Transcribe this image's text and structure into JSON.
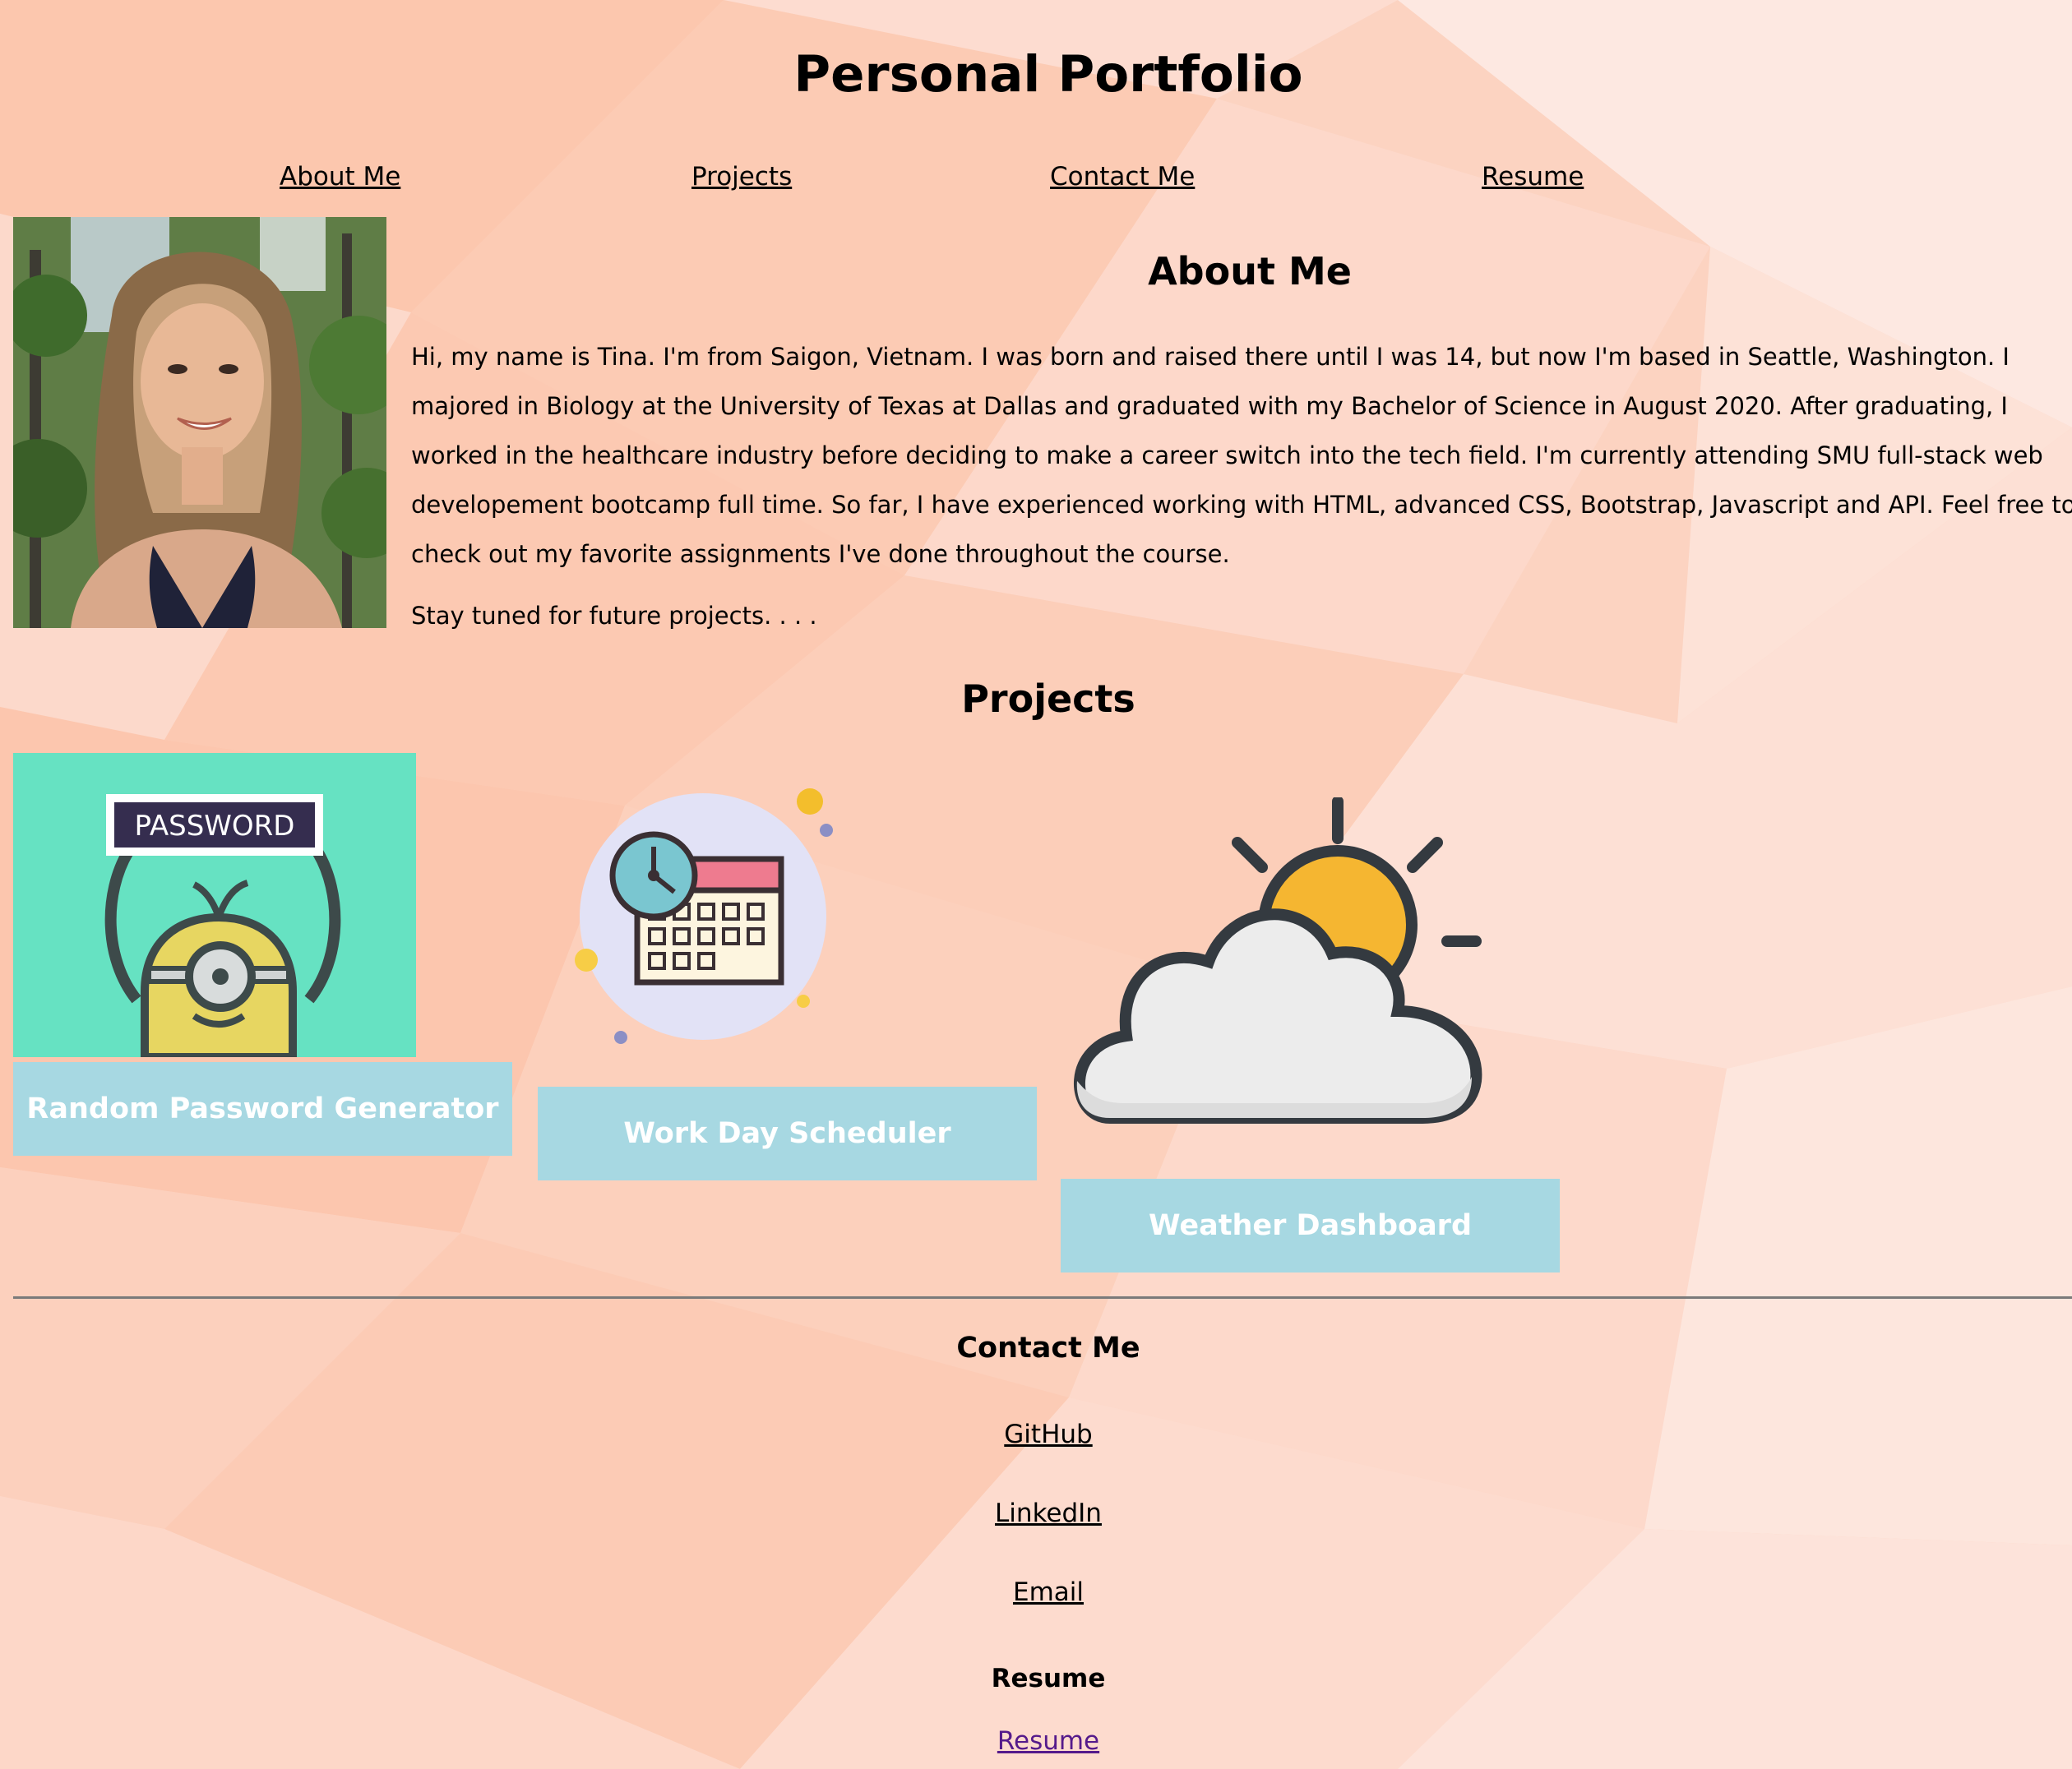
{
  "header": {
    "title": "Personal Portfolio"
  },
  "nav": {
    "items": [
      {
        "label": "About Me"
      },
      {
        "label": "Projects"
      },
      {
        "label": "Contact Me"
      },
      {
        "label": "Resume"
      }
    ]
  },
  "about": {
    "heading": "About Me",
    "text": "Hi, my name is Tina. I'm from Saigon, Vietnam. I was born and raised there until I was 14, but now I'm based in Seattle, Washington. I majored in Biology at the University of Texas at Dallas and graduated with my Bachelor of Science in August 2020. After graduating, I worked in the healthcare industry before deciding to make a career switch into the tech field. I'm currently attending SMU full-stack web developement bootcamp full time. So far, I have experienced working with HTML, advanced CSS, Bootstrap, Javascript and API. Feel free to check out my favorite assignments I've done throughout the course.",
    "outro": "Stay tuned for future projects. . . ."
  },
  "projects": {
    "heading": "Projects",
    "items": [
      {
        "label": "Random Password Generator",
        "image_text": "PASSWORD"
      },
      {
        "label": "Work Day Scheduler"
      },
      {
        "label": "Weather Dashboard"
      }
    ]
  },
  "contact": {
    "heading": "Contact Me",
    "links": [
      {
        "label": "GitHub"
      },
      {
        "label": "LinkedIn"
      },
      {
        "label": "Email"
      }
    ]
  },
  "resume": {
    "heading": "Resume",
    "link": "Resume"
  },
  "colors": {
    "background": "#fcd4c2",
    "button": "#a7d8e2",
    "button_text": "#ffffff",
    "password_bg": "#66e2c2",
    "visited_link": "#551a8b"
  }
}
